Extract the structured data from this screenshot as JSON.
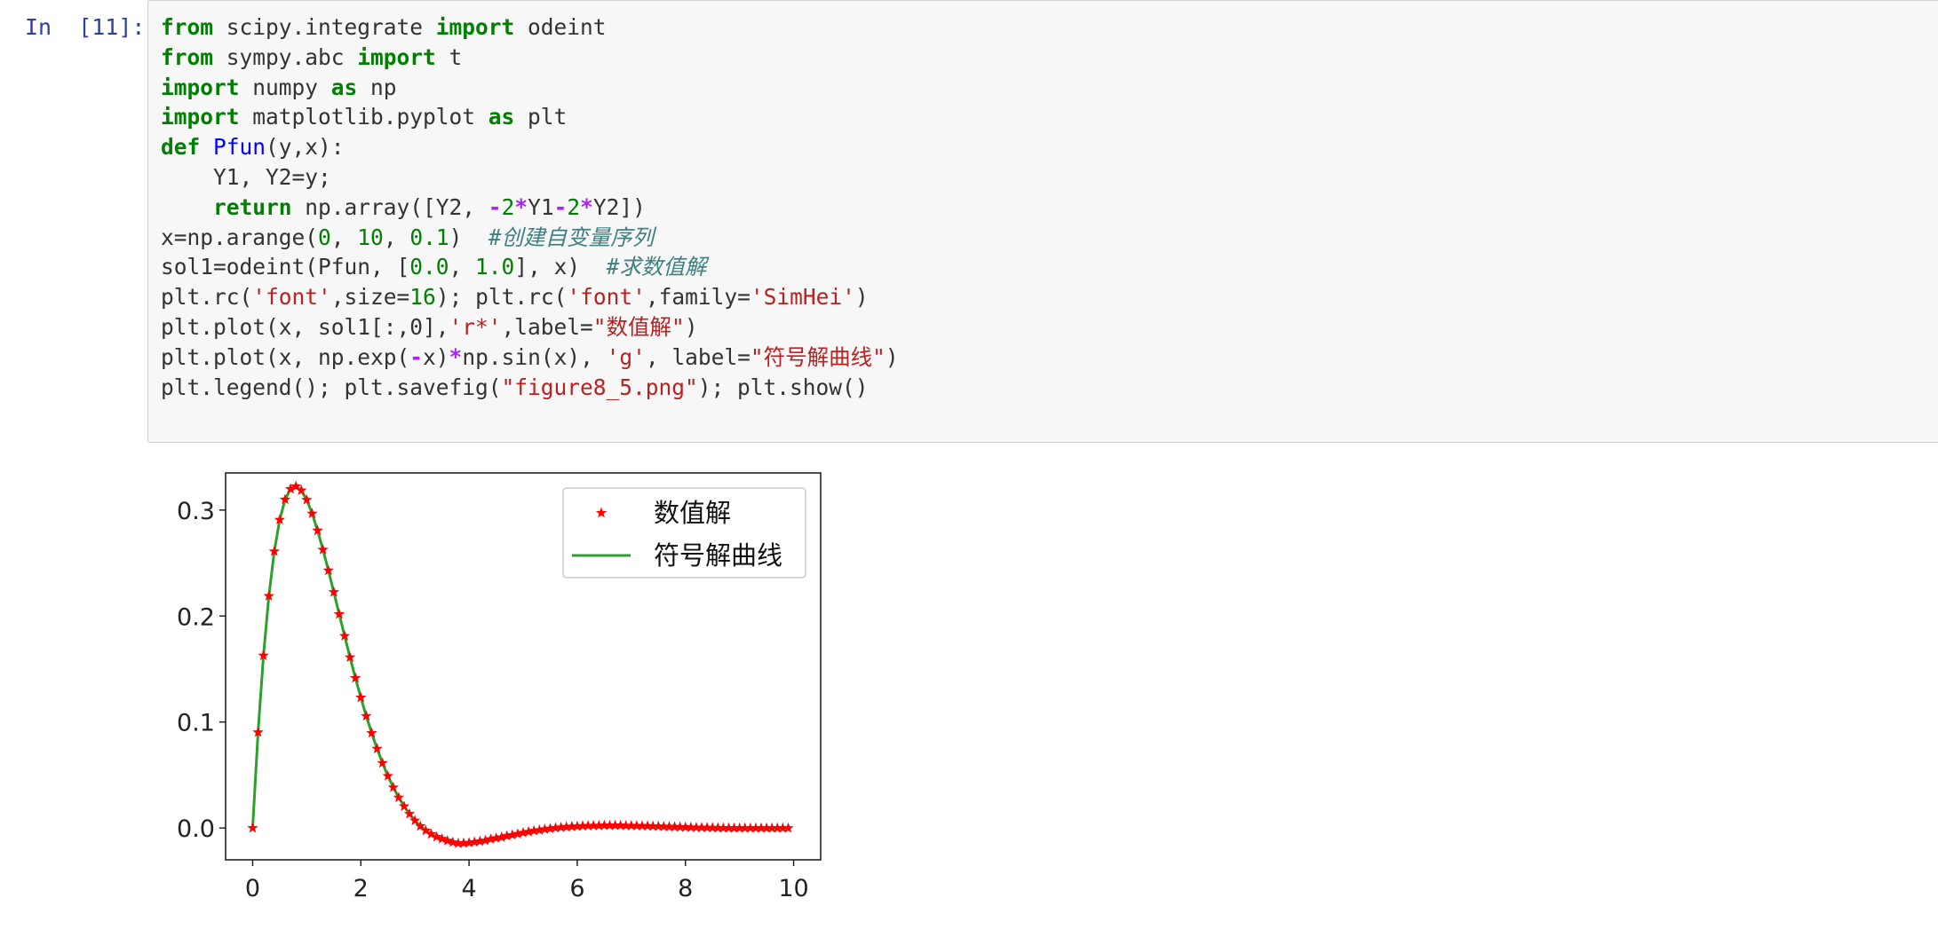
{
  "cell": {
    "prompt": "In  [11]:",
    "code_lines": [
      [
        [
          "kw",
          "from"
        ],
        [
          "t",
          " scipy.integrate "
        ],
        [
          "kw",
          "import"
        ],
        [
          "t",
          " odeint"
        ]
      ],
      [
        [
          "kw",
          "from"
        ],
        [
          "t",
          " sympy.abc "
        ],
        [
          "kw",
          "import"
        ],
        [
          "t",
          " t"
        ]
      ],
      [
        [
          "kw",
          "import"
        ],
        [
          "t",
          " numpy "
        ],
        [
          "kw",
          "as"
        ],
        [
          "t",
          " np"
        ]
      ],
      [
        [
          "kw",
          "import"
        ],
        [
          "t",
          " matplotlib.pyplot "
        ],
        [
          "kw",
          "as"
        ],
        [
          "t",
          " plt"
        ]
      ],
      [
        [
          "kw",
          "def"
        ],
        [
          "t",
          " "
        ],
        [
          "fn",
          "Pfun"
        ],
        [
          "t",
          "(y,x):"
        ]
      ],
      [
        [
          "t",
          "    Y1, Y2=y;"
        ]
      ],
      [
        [
          "t",
          "    "
        ],
        [
          "kw",
          "return"
        ],
        [
          "t",
          " np.array([Y2, "
        ],
        [
          "op",
          "-"
        ],
        [
          "num",
          "2"
        ],
        [
          "op",
          "*"
        ],
        [
          "t",
          "Y1"
        ],
        [
          "op",
          "-"
        ],
        [
          "num",
          "2"
        ],
        [
          "op",
          "*"
        ],
        [
          "t",
          "Y2])"
        ]
      ],
      [
        [
          "t",
          "x=np.arange("
        ],
        [
          "num",
          "0"
        ],
        [
          "t",
          ", "
        ],
        [
          "num",
          "10"
        ],
        [
          "t",
          ", "
        ],
        [
          "num",
          "0.1"
        ],
        [
          "t",
          ")  "
        ],
        [
          "cm",
          "#创建自变量序列"
        ]
      ],
      [
        [
          "t",
          "sol1=odeint(Pfun, ["
        ],
        [
          "num",
          "0.0"
        ],
        [
          "t",
          ", "
        ],
        [
          "num",
          "1.0"
        ],
        [
          "t",
          "], x)  "
        ],
        [
          "cm",
          "#求数值解"
        ]
      ],
      [
        [
          "t",
          "plt.rc("
        ],
        [
          "str",
          "'font'"
        ],
        [
          "t",
          ",size="
        ],
        [
          "num",
          "16"
        ],
        [
          "t",
          "); plt.rc("
        ],
        [
          "str",
          "'font'"
        ],
        [
          "t",
          ",family="
        ],
        [
          "str",
          "'SimHei'"
        ],
        [
          "t",
          ")"
        ]
      ],
      [
        [
          "t",
          "plt.plot(x, sol1[:,0],"
        ],
        [
          "str",
          "'r*'"
        ],
        [
          "t",
          ",label="
        ],
        [
          "str",
          "\"数值解\""
        ],
        [
          "t",
          ")"
        ]
      ],
      [
        [
          "t",
          "plt.plot(x, np.exp("
        ],
        [
          "op",
          "-"
        ],
        [
          "t",
          "x)"
        ],
        [
          "op",
          "*"
        ],
        [
          "t",
          "np.sin(x), "
        ],
        [
          "str",
          "'g'"
        ],
        [
          "t",
          ", label="
        ],
        [
          "str",
          "\"符号解曲线\""
        ],
        [
          "t",
          ")"
        ]
      ],
      [
        [
          "t",
          "plt.legend(); plt.savefig("
        ],
        [
          "str",
          "\"figure8_5.png\""
        ],
        [
          "t",
          "); plt.show()"
        ]
      ]
    ]
  },
  "chart_data": {
    "type": "line",
    "title": "",
    "xlabel": "",
    "ylabel": "",
    "xlim": [
      -0.5,
      10.5
    ],
    "ylim": [
      -0.03,
      0.335
    ],
    "xticks": [
      0,
      2,
      4,
      6,
      8,
      10
    ],
    "xtick_labels": [
      "0",
      "2",
      "4",
      "6",
      "8",
      "10"
    ],
    "yticks": [
      0.0,
      0.1,
      0.2,
      0.3
    ],
    "ytick_labels": [
      "0.0",
      "0.1",
      "0.2",
      "0.3"
    ],
    "grid": false,
    "legend_position": "upper-right",
    "x": [
      0.0,
      0.1,
      0.2,
      0.3,
      0.4,
      0.5,
      0.6,
      0.7,
      0.8,
      0.9,
      1.0,
      1.1,
      1.2,
      1.3,
      1.4,
      1.5,
      1.6,
      1.7,
      1.8,
      1.9,
      2.0,
      2.1,
      2.2,
      2.3,
      2.4,
      2.5,
      2.6,
      2.7,
      2.8,
      2.9,
      3.0,
      3.1,
      3.2,
      3.3,
      3.4,
      3.5,
      3.6,
      3.7,
      3.8,
      3.9,
      4.0,
      4.1,
      4.2,
      4.3,
      4.4,
      4.5,
      4.6,
      4.7,
      4.8,
      4.9,
      5.0,
      5.1,
      5.2,
      5.3,
      5.4,
      5.5,
      5.6,
      5.7,
      5.8,
      5.9,
      6.0,
      6.1,
      6.2,
      6.3,
      6.4,
      6.5,
      6.6,
      6.7,
      6.8,
      6.9,
      7.0,
      7.1,
      7.2,
      7.3,
      7.4,
      7.5,
      7.6,
      7.7,
      7.8,
      7.9,
      8.0,
      8.1,
      8.2,
      8.3,
      8.4,
      8.5,
      8.6,
      8.7,
      8.8,
      8.9,
      9.0,
      9.1,
      9.2,
      9.3,
      9.4,
      9.5,
      9.6,
      9.7,
      9.8,
      9.9
    ],
    "series": [
      {
        "name": "数值解",
        "style": "marker",
        "color": "#ff0000",
        "values": [
          0.0,
          0.0903,
          0.1627,
          0.2189,
          0.261,
          0.2908,
          0.3099,
          0.3199,
          0.3223,
          0.3185,
          0.3096,
          0.2967,
          0.2807,
          0.2626,
          0.243,
          0.2226,
          0.2018,
          0.1812,
          0.161,
          0.1415,
          0.1231,
          0.1057,
          0.0896,
          0.0748,
          0.0613,
          0.0491,
          0.0383,
          0.0288,
          0.0205,
          0.0133,
          0.007,
          0.0018,
          -0.0024,
          -0.0057,
          -0.0083,
          -0.0102,
          -0.012,
          -0.0135,
          -0.0145,
          -0.0143,
          -0.0139,
          -0.0133,
          -0.0126,
          -0.0118,
          -0.0105,
          -0.0096,
          -0.0087,
          -0.0075,
          -0.0066,
          -0.0056,
          -0.0045,
          -0.0036,
          -0.0026,
          -0.002,
          -0.0012,
          -0.0005,
          0.0001,
          0.0006,
          0.001,
          0.0014,
          0.0016,
          0.0019,
          0.0021,
          0.0022,
          0.0022,
          0.0024,
          0.0024,
          0.0024,
          0.0024,
          0.0022,
          0.0022,
          0.0021,
          0.002,
          0.0019,
          0.0017,
          0.0016,
          0.0014,
          0.0012,
          0.0011,
          0.0009,
          0.0008,
          0.0006,
          0.0005,
          0.0004,
          0.0003,
          0.0002,
          0.0001,
          0.0,
          0.0,
          -0.0001,
          -0.0001,
          -0.0001,
          -0.0001,
          -0.0001,
          -0.0001,
          -0.0001,
          -0.0001,
          -0.0001,
          -0.0001,
          -0.0001
        ]
      },
      {
        "name": "符号解曲线",
        "style": "line",
        "color": "#2ca02c",
        "values": [
          0.0,
          0.0903,
          0.1627,
          0.2189,
          0.261,
          0.2908,
          0.3099,
          0.3199,
          0.3223,
          0.3185,
          0.3096,
          0.2967,
          0.2807,
          0.2626,
          0.243,
          0.2226,
          0.2018,
          0.1812,
          0.161,
          0.1415,
          0.1231,
          0.1057,
          0.0896,
          0.0748,
          0.0613,
          0.0491,
          0.0383,
          0.0288,
          0.0205,
          0.0133,
          0.007,
          0.0018,
          -0.0024,
          -0.0057,
          -0.0083,
          -0.0102,
          -0.012,
          -0.0135,
          -0.0145,
          -0.0143,
          -0.0139,
          -0.0133,
          -0.0126,
          -0.0118,
          -0.0105,
          -0.0096,
          -0.0087,
          -0.0075,
          -0.0066,
          -0.0056,
          -0.0045,
          -0.0036,
          -0.0026,
          -0.002,
          -0.0012,
          -0.0005,
          0.0001,
          0.0006,
          0.001,
          0.0014,
          0.0016,
          0.0019,
          0.0021,
          0.0022,
          0.0022,
          0.0024,
          0.0024,
          0.0024,
          0.0024,
          0.0022,
          0.0022,
          0.0021,
          0.002,
          0.0019,
          0.0017,
          0.0016,
          0.0014,
          0.0012,
          0.0011,
          0.0009,
          0.0008,
          0.0006,
          0.0005,
          0.0004,
          0.0003,
          0.0002,
          0.0001,
          0.0,
          0.0,
          -0.0001,
          -0.0001,
          -0.0001,
          -0.0001,
          -0.0001,
          -0.0001,
          -0.0001,
          -0.0001,
          -0.0001,
          -0.0001,
          -0.0001
        ]
      }
    ]
  }
}
